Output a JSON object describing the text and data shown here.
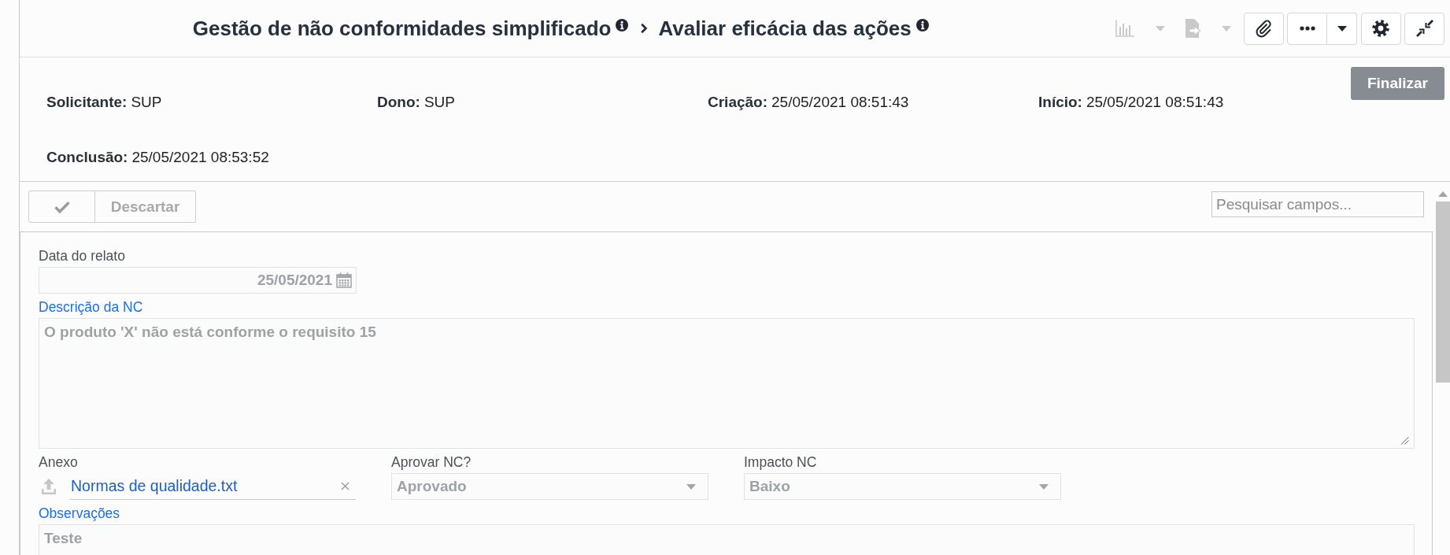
{
  "header": {
    "breadcrumb": [
      {
        "text": "Gestão de não conformidades simplificado",
        "info": true
      },
      {
        "text": "Avaliar eficácia das ações",
        "info": true
      }
    ],
    "toolbar": [
      {
        "kind": "chart",
        "disabled": true
      },
      {
        "kind": "export",
        "disabled": true
      },
      {
        "kind": "attach",
        "disabled": false
      },
      {
        "kind": "more",
        "disabled": false
      },
      {
        "kind": "settings",
        "disabled": false
      },
      {
        "kind": "collapse",
        "disabled": false
      }
    ]
  },
  "summary": {
    "details": [
      {
        "label": "Solicitante:",
        "value": "SUP"
      },
      {
        "label": "Dono:",
        "value": "SUP"
      },
      {
        "label": "Criação:",
        "value": "25/05/2021 08:51:43"
      },
      {
        "label": "Início:",
        "value": "25/05/2021 08:51:43"
      },
      {
        "label": "Conclusão:",
        "value": "25/05/2021 08:53:52"
      }
    ],
    "action": {
      "label": "Finalizar"
    }
  },
  "form": {
    "toolbar": {
      "buttons": [
        {
          "kind": "confirm",
          "disabled": true
        },
        {
          "kind": "discard",
          "label": "Descartar",
          "disabled": true
        }
      ],
      "search": {
        "placeholder": "Pesquisar campos..."
      }
    },
    "fields": [
      {
        "kind": "date",
        "label": "Data do relato",
        "value": "25/05/2021",
        "highlighted": false,
        "disabled": true
      },
      {
        "kind": "textarea",
        "label": "Descrição da NC",
        "value": "O produto 'X' não está conforme o requisito 15",
        "highlighted": true,
        "disabled": true
      },
      {
        "kind": "row",
        "fields": [
          {
            "kind": "file",
            "label": "Anexo",
            "value": "Normas de qualidade.txt",
            "highlighted": false,
            "disabled": true
          },
          {
            "kind": "select",
            "label": "Aprovar NC?",
            "value": "Aprovado",
            "highlighted": false,
            "disabled": true
          },
          {
            "kind": "select",
            "label": "Impacto NC",
            "value": "Baixo",
            "highlighted": false,
            "disabled": true
          }
        ]
      },
      {
        "kind": "textarea",
        "label": "Observações",
        "value": "Teste",
        "highlighted": true,
        "disabled": true
      }
    ]
  }
}
